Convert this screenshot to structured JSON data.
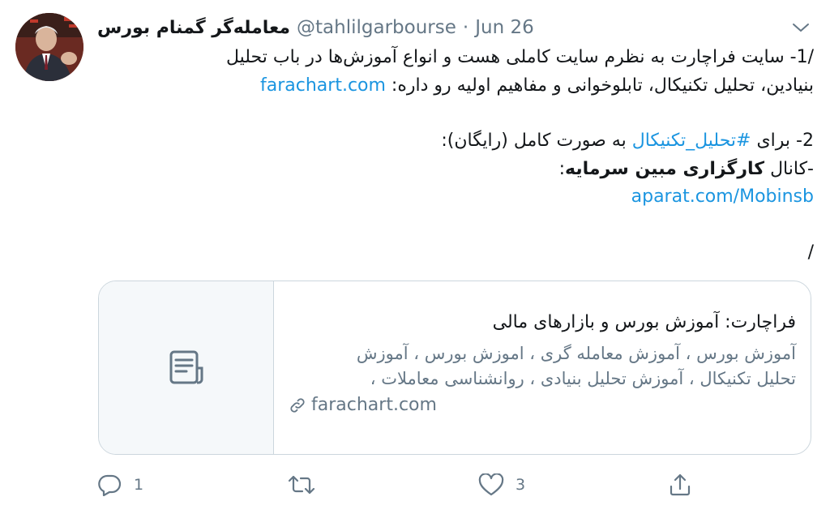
{
  "author": {
    "display_name": "معامله‌گر گمنام بورس",
    "handle": "@tahlilgarbourse",
    "separator": "·",
    "date": "Jun 26"
  },
  "body": {
    "line1": "/1- سایت فراچارت به نظرم سایت کاملی هست و انواع آموزش‌ها در باب تحلیل",
    "line2_text": "بنیادین، تحلیل تکنیکال، تابلوخوانی و مفاهیم اولیه رو داره: ",
    "line2_link": "farachart.com",
    "line3_pre": "2- برای ",
    "line3_hashtag": "#تحلیل_تکنیکال",
    "line3_post": " به صورت کامل (رایگان):",
    "line4_pre": "-کانال ",
    "line4_bold": "کارگزاری مبین سرمایه",
    "line4_post": ":",
    "line5_link": "aparat.com/Mobinsb",
    "line6": "/"
  },
  "card": {
    "title": "فراچارت: آموزش بورس و بازارهای مالی",
    "desc_line1": "آموزش بورس ، آموزش معامله گری ، اموزش بورس ، آموزش",
    "desc_line2": "تحلیل تکنیکال ، آموزش تحلیل بنیادی ، روانشناسی معاملات ،",
    "domain": "farachart.com",
    "media_icon": "document-icon"
  },
  "actions": {
    "reply_count": "1",
    "retweet_count": "",
    "like_count": "3"
  },
  "colors": {
    "link": "#1b95e0",
    "secondary_text": "#657786",
    "border": "#ccd6dd"
  }
}
